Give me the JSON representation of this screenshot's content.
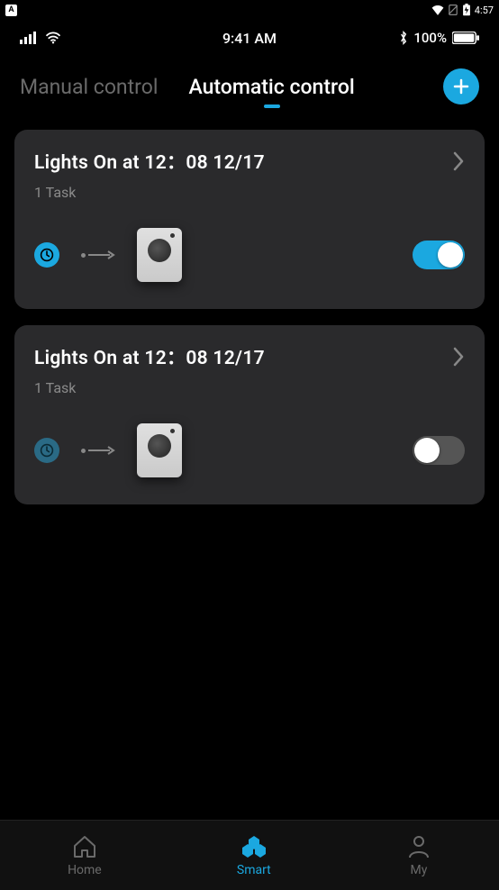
{
  "system_status": {
    "badge": "A",
    "clock": "4:57"
  },
  "app_status": {
    "time": "9:41 AM",
    "battery": "100%"
  },
  "tabs": {
    "manual": "Manual control",
    "automatic": "Automatic control",
    "active": "automatic"
  },
  "tasks": [
    {
      "title": "Lights On at 12：08 12/17",
      "sub": "1 Task",
      "enabled": true
    },
    {
      "title": "Lights On at 12：08 12/17",
      "sub": "1 Task",
      "enabled": false
    }
  ],
  "nav": {
    "home": "Home",
    "smart": "Smart",
    "my": "My",
    "active": "smart"
  }
}
